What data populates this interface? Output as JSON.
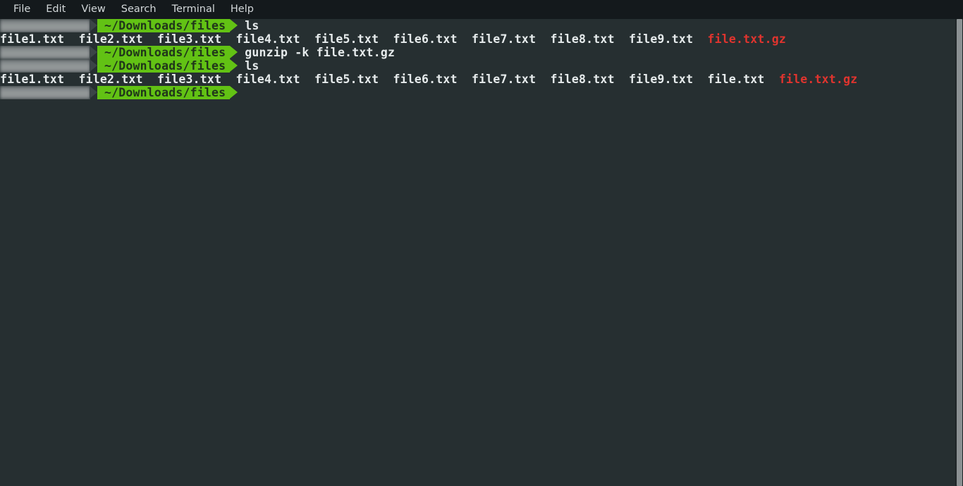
{
  "window": {
    "title": "Terminal",
    "background_color": "#262f31",
    "menubar_color": "#14191c"
  },
  "menubar": {
    "items": [
      {
        "label": "File"
      },
      {
        "label": "Edit"
      },
      {
        "label": "View"
      },
      {
        "label": "Search"
      },
      {
        "label": "Terminal"
      },
      {
        "label": "Help"
      }
    ]
  },
  "colors": {
    "prompt_green": "#62c214",
    "prompt_green_text": "#20361a",
    "output_text": "#e6ebec",
    "archive_red": "#e0342e",
    "user_segment_redacted": "#8b9092",
    "scrollbar_thumb": "#8b9193"
  },
  "terminal": {
    "prompt_path": "~/Downloads/files",
    "user_segment_label": "",
    "lines": [
      {
        "type": "prompt",
        "path": "~/Downloads/files",
        "command": "ls"
      },
      {
        "type": "output",
        "files": [
          {
            "name": "file1.txt",
            "color": "#e6ebec"
          },
          {
            "name": "file2.txt",
            "color": "#e6ebec"
          },
          {
            "name": "file3.txt",
            "color": "#e6ebec"
          },
          {
            "name": "file4.txt",
            "color": "#e6ebec"
          },
          {
            "name": "file5.txt",
            "color": "#e6ebec"
          },
          {
            "name": "file6.txt",
            "color": "#e6ebec"
          },
          {
            "name": "file7.txt",
            "color": "#e6ebec"
          },
          {
            "name": "file8.txt",
            "color": "#e6ebec"
          },
          {
            "name": "file9.txt",
            "color": "#e6ebec"
          },
          {
            "name": "file.txt.gz",
            "color": "#e0342e"
          }
        ]
      },
      {
        "type": "prompt",
        "path": "~/Downloads/files",
        "command": "gunzip -k file.txt.gz"
      },
      {
        "type": "prompt",
        "path": "~/Downloads/files",
        "command": "ls"
      },
      {
        "type": "output",
        "files": [
          {
            "name": "file1.txt",
            "color": "#e6ebec"
          },
          {
            "name": "file2.txt",
            "color": "#e6ebec"
          },
          {
            "name": "file3.txt",
            "color": "#e6ebec"
          },
          {
            "name": "file4.txt",
            "color": "#e6ebec"
          },
          {
            "name": "file5.txt",
            "color": "#e6ebec"
          },
          {
            "name": "file6.txt",
            "color": "#e6ebec"
          },
          {
            "name": "file7.txt",
            "color": "#e6ebec"
          },
          {
            "name": "file8.txt",
            "color": "#e6ebec"
          },
          {
            "name": "file9.txt",
            "color": "#e6ebec"
          },
          {
            "name": "file.txt",
            "color": "#e6ebec"
          },
          {
            "name": "file.txt.gz",
            "color": "#e0342e"
          }
        ]
      },
      {
        "type": "prompt",
        "path": "~/Downloads/files",
        "command": ""
      }
    ]
  },
  "scrollbar": {
    "orientation": "vertical",
    "thumb_fraction": 1.0
  }
}
